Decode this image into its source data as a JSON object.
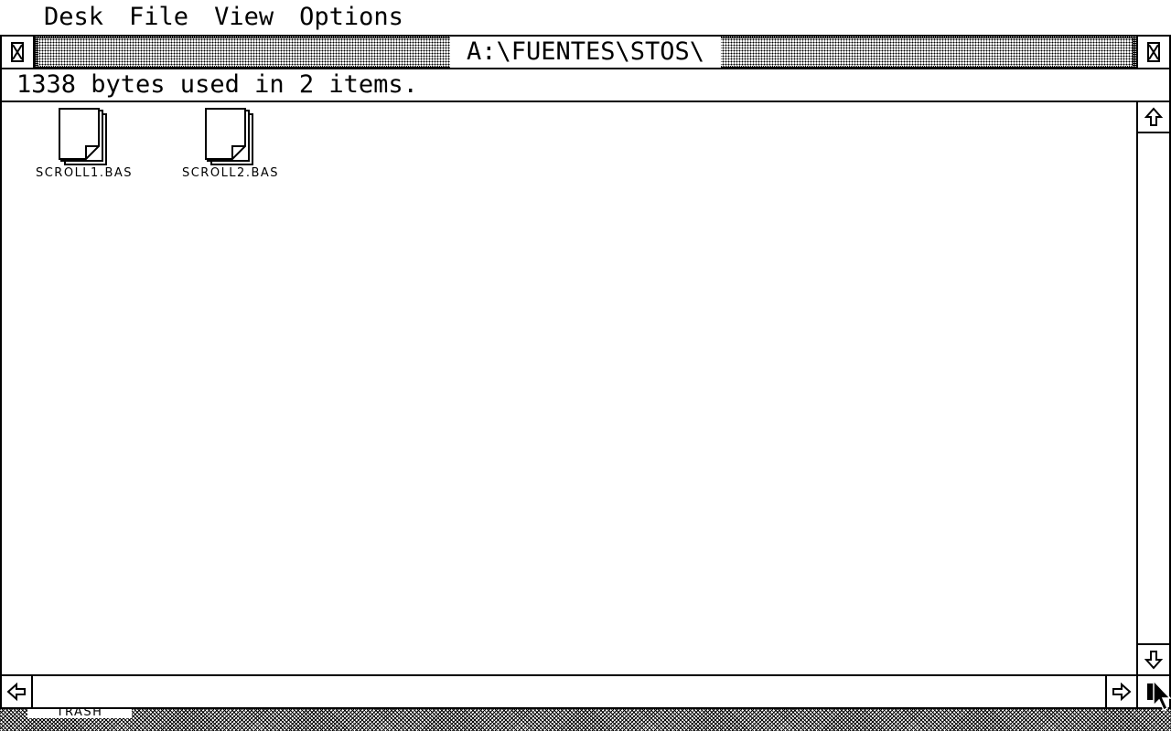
{
  "menubar": {
    "items": [
      {
        "label": "Desk"
      },
      {
        "label": "File"
      },
      {
        "label": "View"
      },
      {
        "label": "Options"
      }
    ]
  },
  "window": {
    "title": "A:\\FUENTES\\STOS\\",
    "info": "1338 bytes used in 2 items.",
    "files": [
      {
        "name": "SCROLL1.BAS",
        "icon": "document-icon"
      },
      {
        "name": "SCROLL2.BAS",
        "icon": "document-icon"
      }
    ]
  },
  "desktop": {
    "trash_label": "TRASH"
  },
  "icons": {
    "close": "close-box-icon",
    "fuller": "full-box-icon",
    "up": "arrow-up-icon",
    "down": "arrow-down-icon",
    "left": "arrow-left-icon",
    "right": "arrow-right-icon",
    "sizer": "size-box-icon",
    "pointer": "mouse-pointer-icon"
  }
}
